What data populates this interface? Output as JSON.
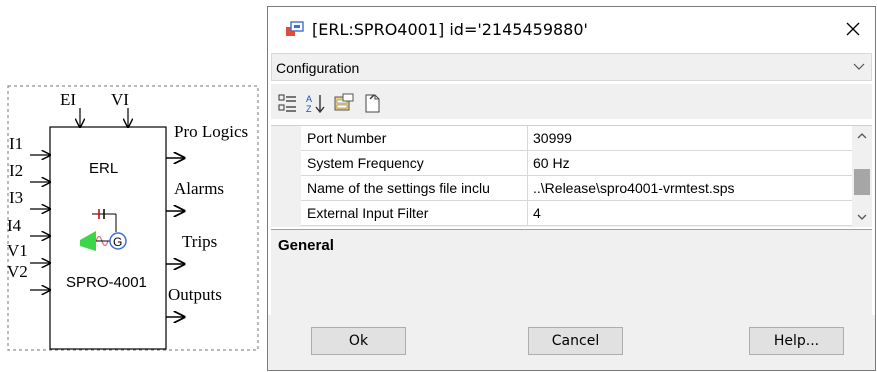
{
  "diagram": {
    "top_inputs": [
      "EI",
      "VI"
    ],
    "left_inputs": [
      "I1",
      "I2",
      "I3",
      "I4",
      "V1",
      "V2"
    ],
    "block_name": "ERL",
    "device_name": "SPRO-4001",
    "outputs": [
      "Pro Logics",
      "Alarms",
      "Trips",
      "Outputs"
    ],
    "symbol_icon": "generator-icon"
  },
  "dialog": {
    "title": "[ERL:SPRO4001] id='2145459880'",
    "section_selected": "Configuration",
    "properties": [
      {
        "name": "Port Number",
        "value": "30999"
      },
      {
        "name": "System Frequency",
        "value": "60 Hz"
      },
      {
        "name": "Name of the settings file inclu",
        "value": "..\\Release\\spro4001-vrmtest.sps"
      },
      {
        "name": "External Input Filter",
        "value": "4"
      }
    ],
    "description_title": "General",
    "buttons": {
      "ok": "Ok",
      "cancel": "Cancel",
      "help": "Help..."
    }
  },
  "colors": {
    "generator_fill": "#3cd64a",
    "generator_wave": "#e07070",
    "scroll_thumb": "#a6a6a6"
  }
}
